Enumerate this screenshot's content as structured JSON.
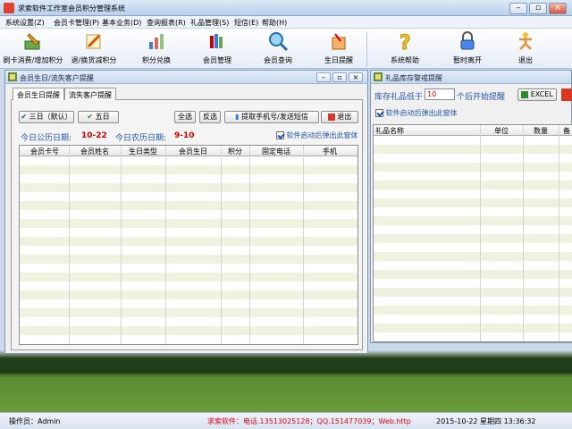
{
  "app": {
    "title": "求索软件工作室会员积分管理系统"
  },
  "colors": {
    "accent": "#e0001a",
    "date_red": "#d00000",
    "grid_stripe": "#eef2df"
  },
  "menu": [
    "系统设置(Z)",
    "会员卡管理(P)",
    "基本业务(D)",
    "查询报表(R)",
    "礼品管理(S)",
    "短信(E)",
    "帮助(H)"
  ],
  "toolbar": [
    {
      "label": "刷卡消费/增加积分",
      "icon": "pen-card-icon"
    },
    {
      "label": "退/换货减积分",
      "icon": "return-pen-icon"
    },
    {
      "label": "积分兑换",
      "icon": "exchange-chart-icon"
    },
    {
      "label": "会员管理",
      "icon": "members-books-icon"
    },
    {
      "label": "会员查询",
      "icon": "magnifier-icon"
    },
    {
      "label": "生日提醒",
      "icon": "birthday-card-icon"
    },
    {
      "label": "系统帮助",
      "icon": "question-icon"
    },
    {
      "label": "暂时离开",
      "icon": "lock-icon"
    },
    {
      "label": "退出",
      "icon": "exit-person-icon"
    }
  ],
  "birthday_window": {
    "title": "会员生日/流失客户提醒",
    "tabs": [
      "会员生日提醒",
      "流失客户提醒"
    ],
    "buttons": {
      "three_days": "三日（默认）",
      "five_days": "五日",
      "select_all": "全选",
      "invert": "反选",
      "fetch_phone": "提取手机号/发送短信",
      "exit": "退出"
    },
    "solar_label": "今日公历日期:",
    "solar_date": "10-22",
    "lunar_label": "今日农历日期:",
    "lunar_date": "9-10",
    "popup_checkbox": "软件启动后弹出此窗体",
    "popup_checked": true,
    "columns": [
      "会员卡号",
      "会员姓名",
      "生日类型",
      "会员生日",
      "积分",
      "固定电话",
      "手机"
    ]
  },
  "gift_window": {
    "title": "礼品库存警戒提醒",
    "stock_label_pre": "库存礼品低于",
    "stock_value": "10",
    "stock_label_post": "个后开始提醒",
    "excel_button": "EXCEL",
    "popup_checkbox": "软件启动后弹出此窗体",
    "popup_checked": true,
    "columns": [
      "礼品名称",
      "单位",
      "数量",
      "备"
    ]
  },
  "status": {
    "operator": "操作员：Admin",
    "contact": "求索软件：电话.13513025128；QQ.151477039；Web.http",
    "datetime": "2015-10-22 星期四 13:36:32"
  }
}
